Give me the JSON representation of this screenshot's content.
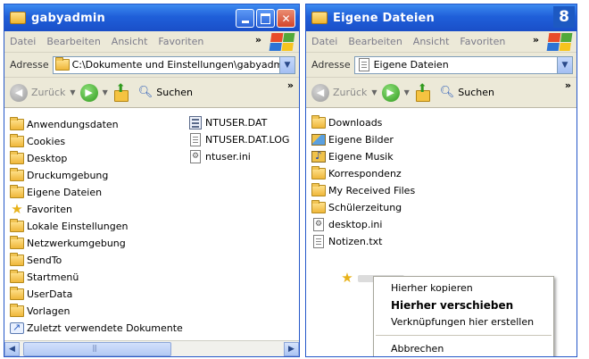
{
  "left_window": {
    "title": "gabyadmin",
    "menu": [
      "Datei",
      "Bearbeiten",
      "Ansicht",
      "Favoriten"
    ],
    "menu_more": "»",
    "address_label": "Adresse",
    "address_value": "C:\\Dokumente und Einstellungen\\gabyadmin",
    "toolbar": {
      "back_label": "Zurück",
      "search_label": "Suchen",
      "more": "»"
    },
    "folders": [
      {
        "name": "Anwendungsdaten",
        "icon": "folder-icon"
      },
      {
        "name": "Cookies",
        "icon": "folder-icon"
      },
      {
        "name": "Desktop",
        "icon": "folder-icon"
      },
      {
        "name": "Druckumgebung",
        "icon": "folder-icon"
      },
      {
        "name": "Eigene Dateien",
        "icon": "folder-icon"
      },
      {
        "name": "Favoriten",
        "icon": "star-icon"
      },
      {
        "name": "Lokale Einstellungen",
        "icon": "folder-icon"
      },
      {
        "name": "Netzwerkumgebung",
        "icon": "folder-icon"
      },
      {
        "name": "SendTo",
        "icon": "folder-icon"
      },
      {
        "name": "Startmenü",
        "icon": "folder-icon"
      },
      {
        "name": "UserData",
        "icon": "folder-icon"
      },
      {
        "name": "Vorlagen",
        "icon": "folder-icon"
      },
      {
        "name": "Zuletzt verwendete Dokumente",
        "icon": "shortcut-icon"
      }
    ],
    "files": [
      {
        "name": "NTUSER.DAT",
        "icon": "dat-file-icon"
      },
      {
        "name": "NTUSER.DAT.LOG",
        "icon": "text-file-icon"
      },
      {
        "name": "ntuser.ini",
        "icon": "settings-file-icon"
      }
    ]
  },
  "right_window": {
    "title": "Eigene Dateien",
    "step_badge": "8",
    "menu": [
      "Datei",
      "Bearbeiten",
      "Ansicht",
      "Favoriten"
    ],
    "menu_more": "»",
    "address_label": "Adresse",
    "address_value": "Eigene Dateien",
    "toolbar": {
      "back_label": "Zurück",
      "search_label": "Suchen",
      "more": "»"
    },
    "items": [
      {
        "name": "Downloads",
        "icon": "folder-icon"
      },
      {
        "name": "Eigene Bilder",
        "icon": "pictures-folder-icon"
      },
      {
        "name": "Eigene Musik",
        "icon": "music-folder-icon"
      },
      {
        "name": "Korrespondenz",
        "icon": "folder-icon"
      },
      {
        "name": "My Received Files",
        "icon": "folder-icon"
      },
      {
        "name": "Schülerzeitung",
        "icon": "folder-icon"
      },
      {
        "name": "desktop.ini",
        "icon": "settings-file-icon"
      },
      {
        "name": "Notizen.txt",
        "icon": "text-file-icon"
      }
    ],
    "context_menu": {
      "copy_here": "Hierher kopieren",
      "move_here": "Hierher verschieben",
      "create_shortcuts": "Verknüpfungen hier erstellen",
      "cancel": "Abbrechen"
    }
  },
  "colors": {
    "titlebar": "#2563d6",
    "chrome": "#ece9d8",
    "folder": "#f0c24a",
    "badge": "#1d59c2"
  }
}
